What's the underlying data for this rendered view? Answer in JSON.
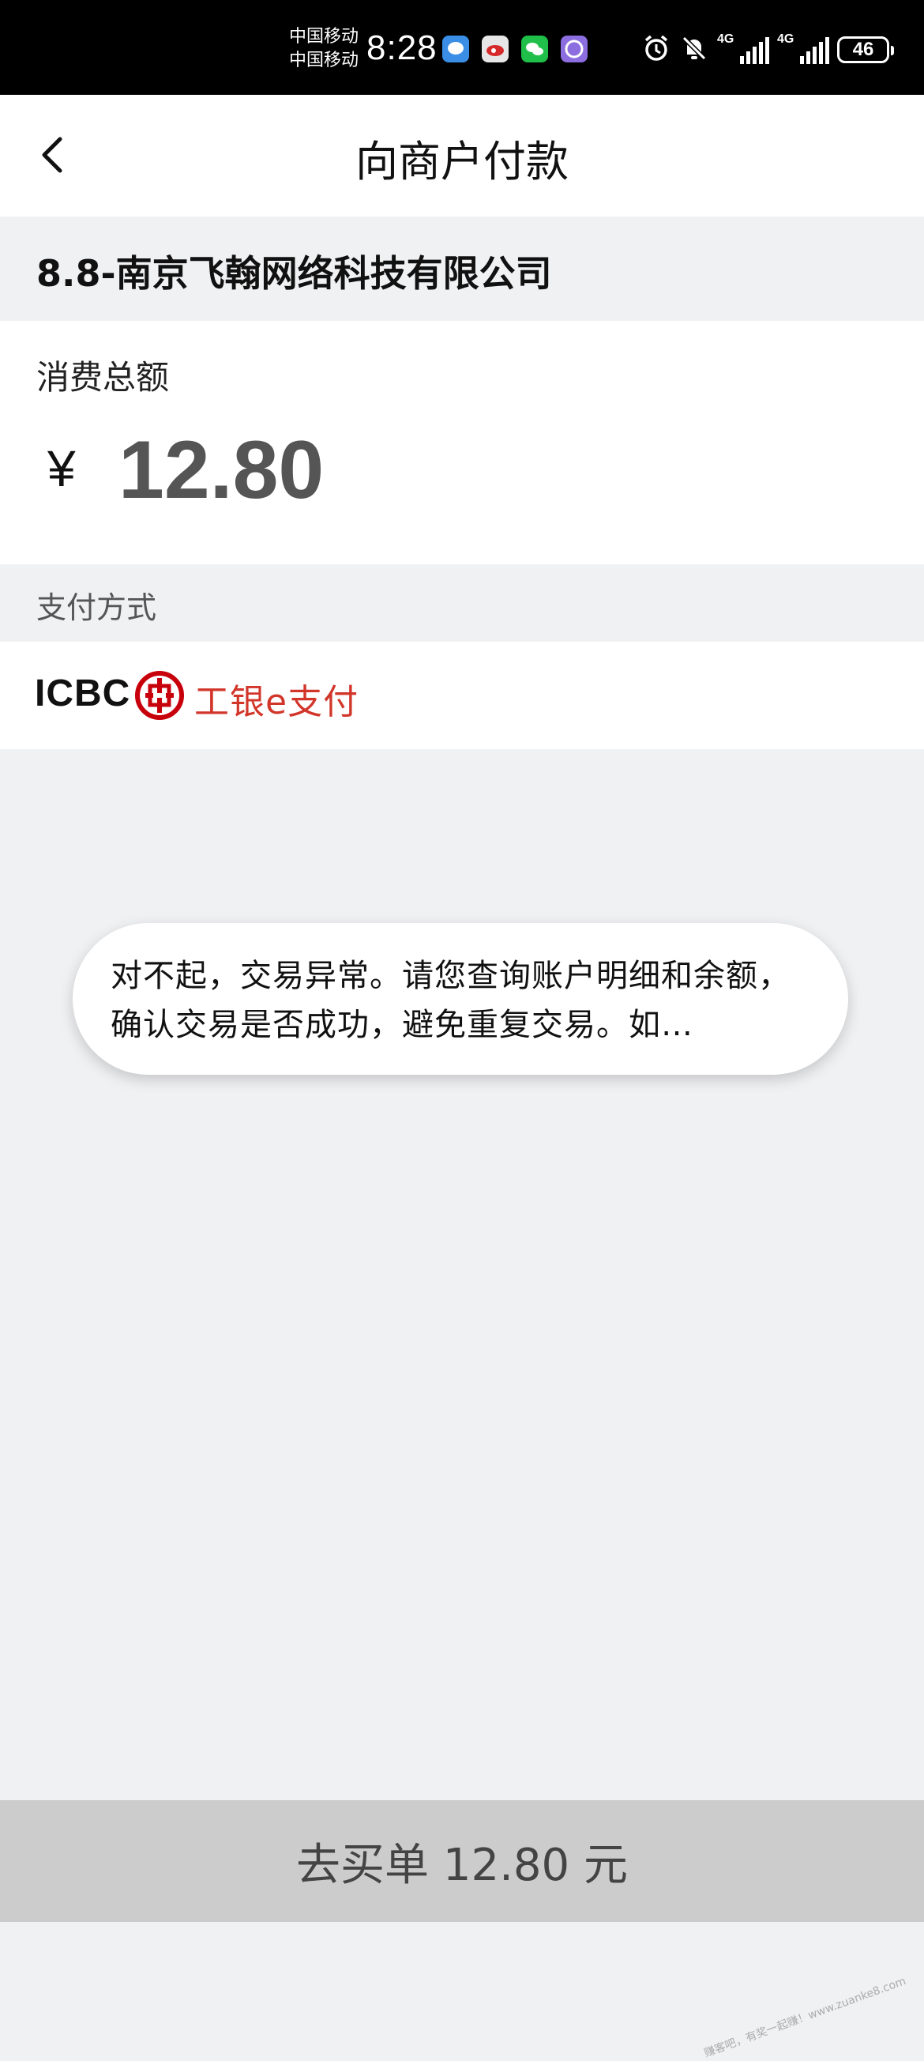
{
  "status_bar": {
    "carrier_1": "中国移动",
    "carrier_2": "中国移动",
    "time": "8:28",
    "network_1": "4G",
    "network_2": "4G",
    "battery": "46",
    "app_icons": [
      "message-app-icon",
      "weibo-app-icon",
      "wechat-app-icon",
      "browser-app-icon"
    ],
    "system_icons": [
      "alarm-icon",
      "mute-icon",
      "signal-icon",
      "signal-icon",
      "battery-icon"
    ]
  },
  "nav": {
    "back_icon": "chevron-left-icon",
    "title": "向商户付款"
  },
  "merchant": {
    "name": "8.8-南京飞翰网络科技有限公司"
  },
  "amount": {
    "label": "消费总额",
    "currency": "¥",
    "value": "12.80"
  },
  "payment_method": {
    "header": "支付方式",
    "bank_code": "ICBC",
    "brand": "工银e支付",
    "logo_icon": "icbc-logo-icon"
  },
  "toast": {
    "message": "对不起，交易异常。请您查询账户明细和余额，确认交易是否成功，避免重复交易。如…"
  },
  "footer": {
    "pay_button": "去买单 12.80 元"
  },
  "watermark": {
    "text": "赚客吧，有奖一起赚！www.zuanke8.com"
  },
  "colors": {
    "page_background": "#f0f1f3",
    "card_background": "#ffffff",
    "icbc_red": "#c7000b",
    "button_background": "#cccccc"
  }
}
